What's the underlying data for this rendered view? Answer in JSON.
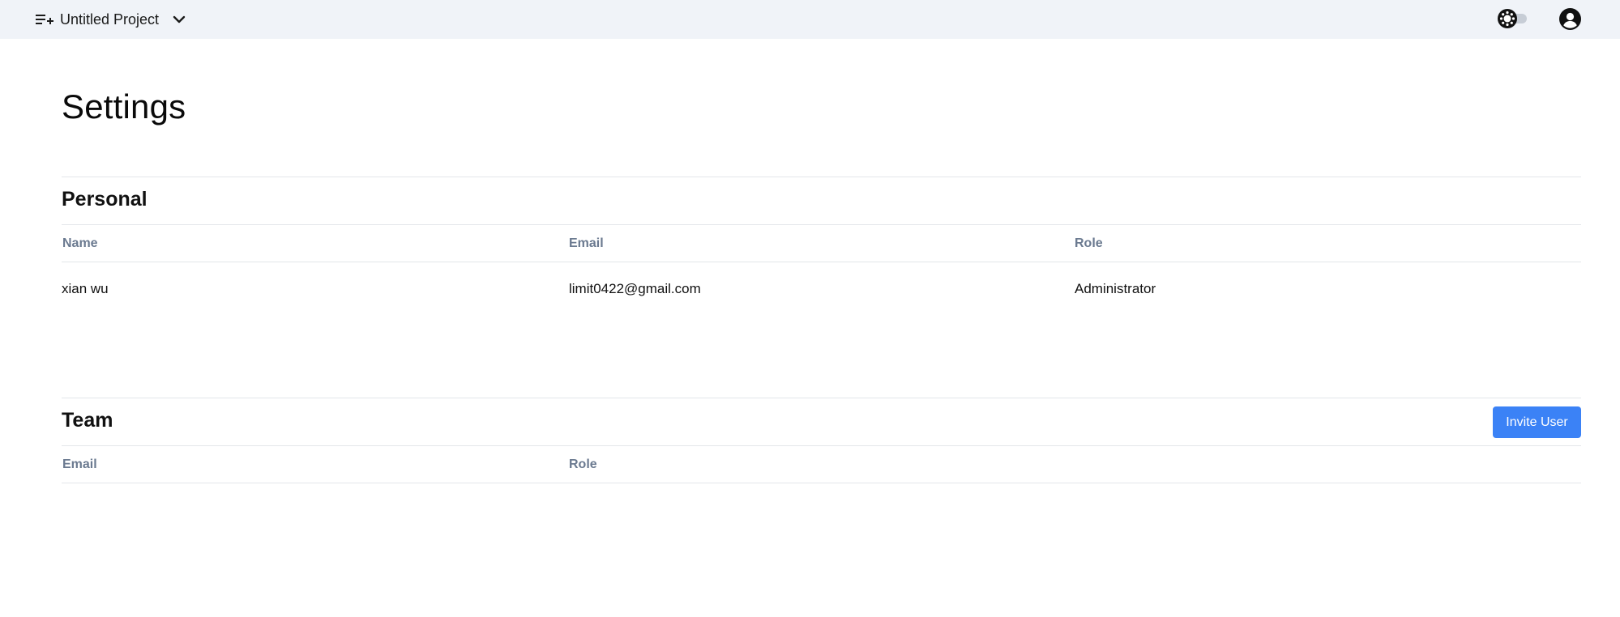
{
  "header": {
    "project_name": "Untitled Project",
    "project_icon": "playlist-add-icon",
    "dropdown_icon": "chevron-down-icon",
    "theme_toggle_icon": "sun-icon",
    "account_icon": "account-circle-icon"
  },
  "page": {
    "title": "Settings"
  },
  "personal": {
    "title": "Personal",
    "columns": [
      "Name",
      "Email",
      "Role"
    ],
    "rows": [
      {
        "name": "xian wu",
        "email": "limit0422@gmail.com",
        "role": "Administrator"
      }
    ]
  },
  "team": {
    "title": "Team",
    "invite_label": "Invite User",
    "columns": [
      "Email",
      "Role"
    ],
    "rows": []
  },
  "colors": {
    "topbar_bg": "#f0f3f8",
    "accent": "#3b82f6",
    "column_header": "#6b7a90",
    "divider": "#e3e6ea"
  }
}
